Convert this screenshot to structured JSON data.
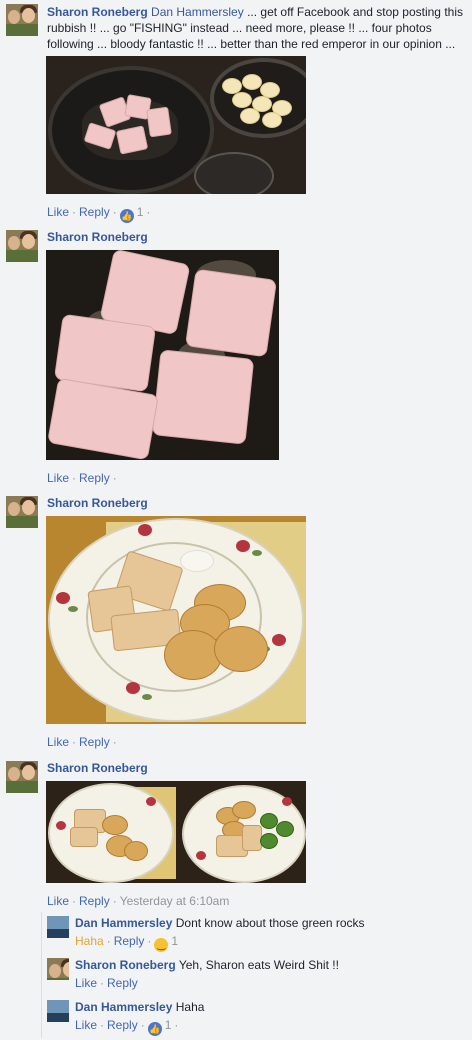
{
  "comments": [
    {
      "author": "Sharon Roneberg",
      "mention": "Dan Hammersley",
      "text": " ... get off Facebook and stop posting this rubbish !! ... go \"FISHING\" instead ... need more, please !! ... four photos following ... bloody fantastic !! ... better than the red emperor in our opinion ... ...",
      "actions": {
        "like": "Like",
        "reply": "Reply",
        "reaction_count": "1"
      }
    },
    {
      "author": "Sharon Roneberg",
      "actions": {
        "like": "Like",
        "reply": "Reply"
      }
    },
    {
      "author": "Sharon Roneberg",
      "actions": {
        "like": "Like",
        "reply": "Reply"
      }
    },
    {
      "author": "Sharon Roneberg",
      "actions": {
        "like": "Like",
        "reply": "Reply",
        "timestamp": "Yesterday at 6:10am"
      }
    }
  ],
  "replies": [
    {
      "author": "Dan Hammersley",
      "text": "Dont know about those green rocks",
      "actions": {
        "reaction_label": "Haha",
        "reply": "Reply",
        "reaction_count": "1"
      }
    },
    {
      "author": "Sharon Roneberg",
      "text": "Yeh, Sharon eats Weird Shit !!",
      "actions": {
        "like": "Like",
        "reply": "Reply"
      }
    },
    {
      "author": "Dan Hammersley",
      "text": "Haha",
      "actions": {
        "like": "Like",
        "reply": "Reply",
        "reaction_count": "1"
      }
    }
  ],
  "icons": {
    "like_reaction": "thumbs-up-icon",
    "haha_reaction": "laughing-face-icon"
  },
  "colors": {
    "link": "#365899",
    "action_link": "#4267b2",
    "meta": "#90949c",
    "haha": "#e7a330",
    "background": "#f2f3f5"
  }
}
